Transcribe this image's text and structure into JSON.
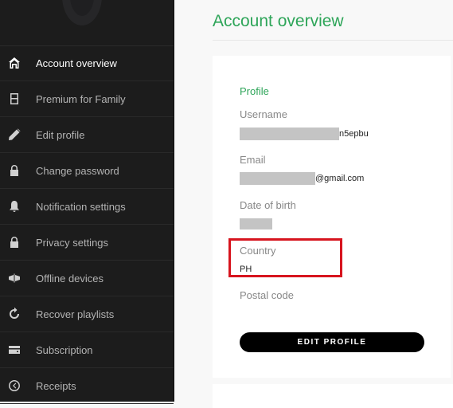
{
  "sidebar": {
    "items": [
      {
        "label": "Account overview",
        "icon": "home-icon",
        "active": true
      },
      {
        "label": "Premium for Family",
        "icon": "family-plan-icon",
        "active": false
      },
      {
        "label": "Edit profile",
        "icon": "pencil-icon",
        "active": false
      },
      {
        "label": "Change password",
        "icon": "lock-icon",
        "active": false
      },
      {
        "label": "Notification settings",
        "icon": "bell-icon",
        "active": false
      },
      {
        "label": "Privacy settings",
        "icon": "lock-icon",
        "active": false
      },
      {
        "label": "Offline devices",
        "icon": "devices-icon",
        "active": false
      },
      {
        "label": "Recover playlists",
        "icon": "refresh-icon",
        "active": false
      },
      {
        "label": "Subscription",
        "icon": "card-icon",
        "active": false
      },
      {
        "label": "Receipts",
        "icon": "clock-icon",
        "active": false
      }
    ]
  },
  "main": {
    "title": "Account overview",
    "profile": {
      "section_title": "Profile",
      "fields": {
        "username": {
          "label": "Username",
          "value_visible_suffix": "n5epbu"
        },
        "email": {
          "label": "Email",
          "value_visible_suffix": "@gmail.com"
        },
        "date_of_birth": {
          "label": "Date of birth",
          "value_visible_suffix": ""
        },
        "country": {
          "label": "Country",
          "value": "PH"
        },
        "postal_code": {
          "label": "Postal code",
          "value": ""
        }
      },
      "edit_button_label": "EDIT PROFILE"
    }
  },
  "colors": {
    "accent_green": "#2ea559",
    "sidebar_bg": "#1c1c1c",
    "highlight_red": "#d7141e"
  }
}
